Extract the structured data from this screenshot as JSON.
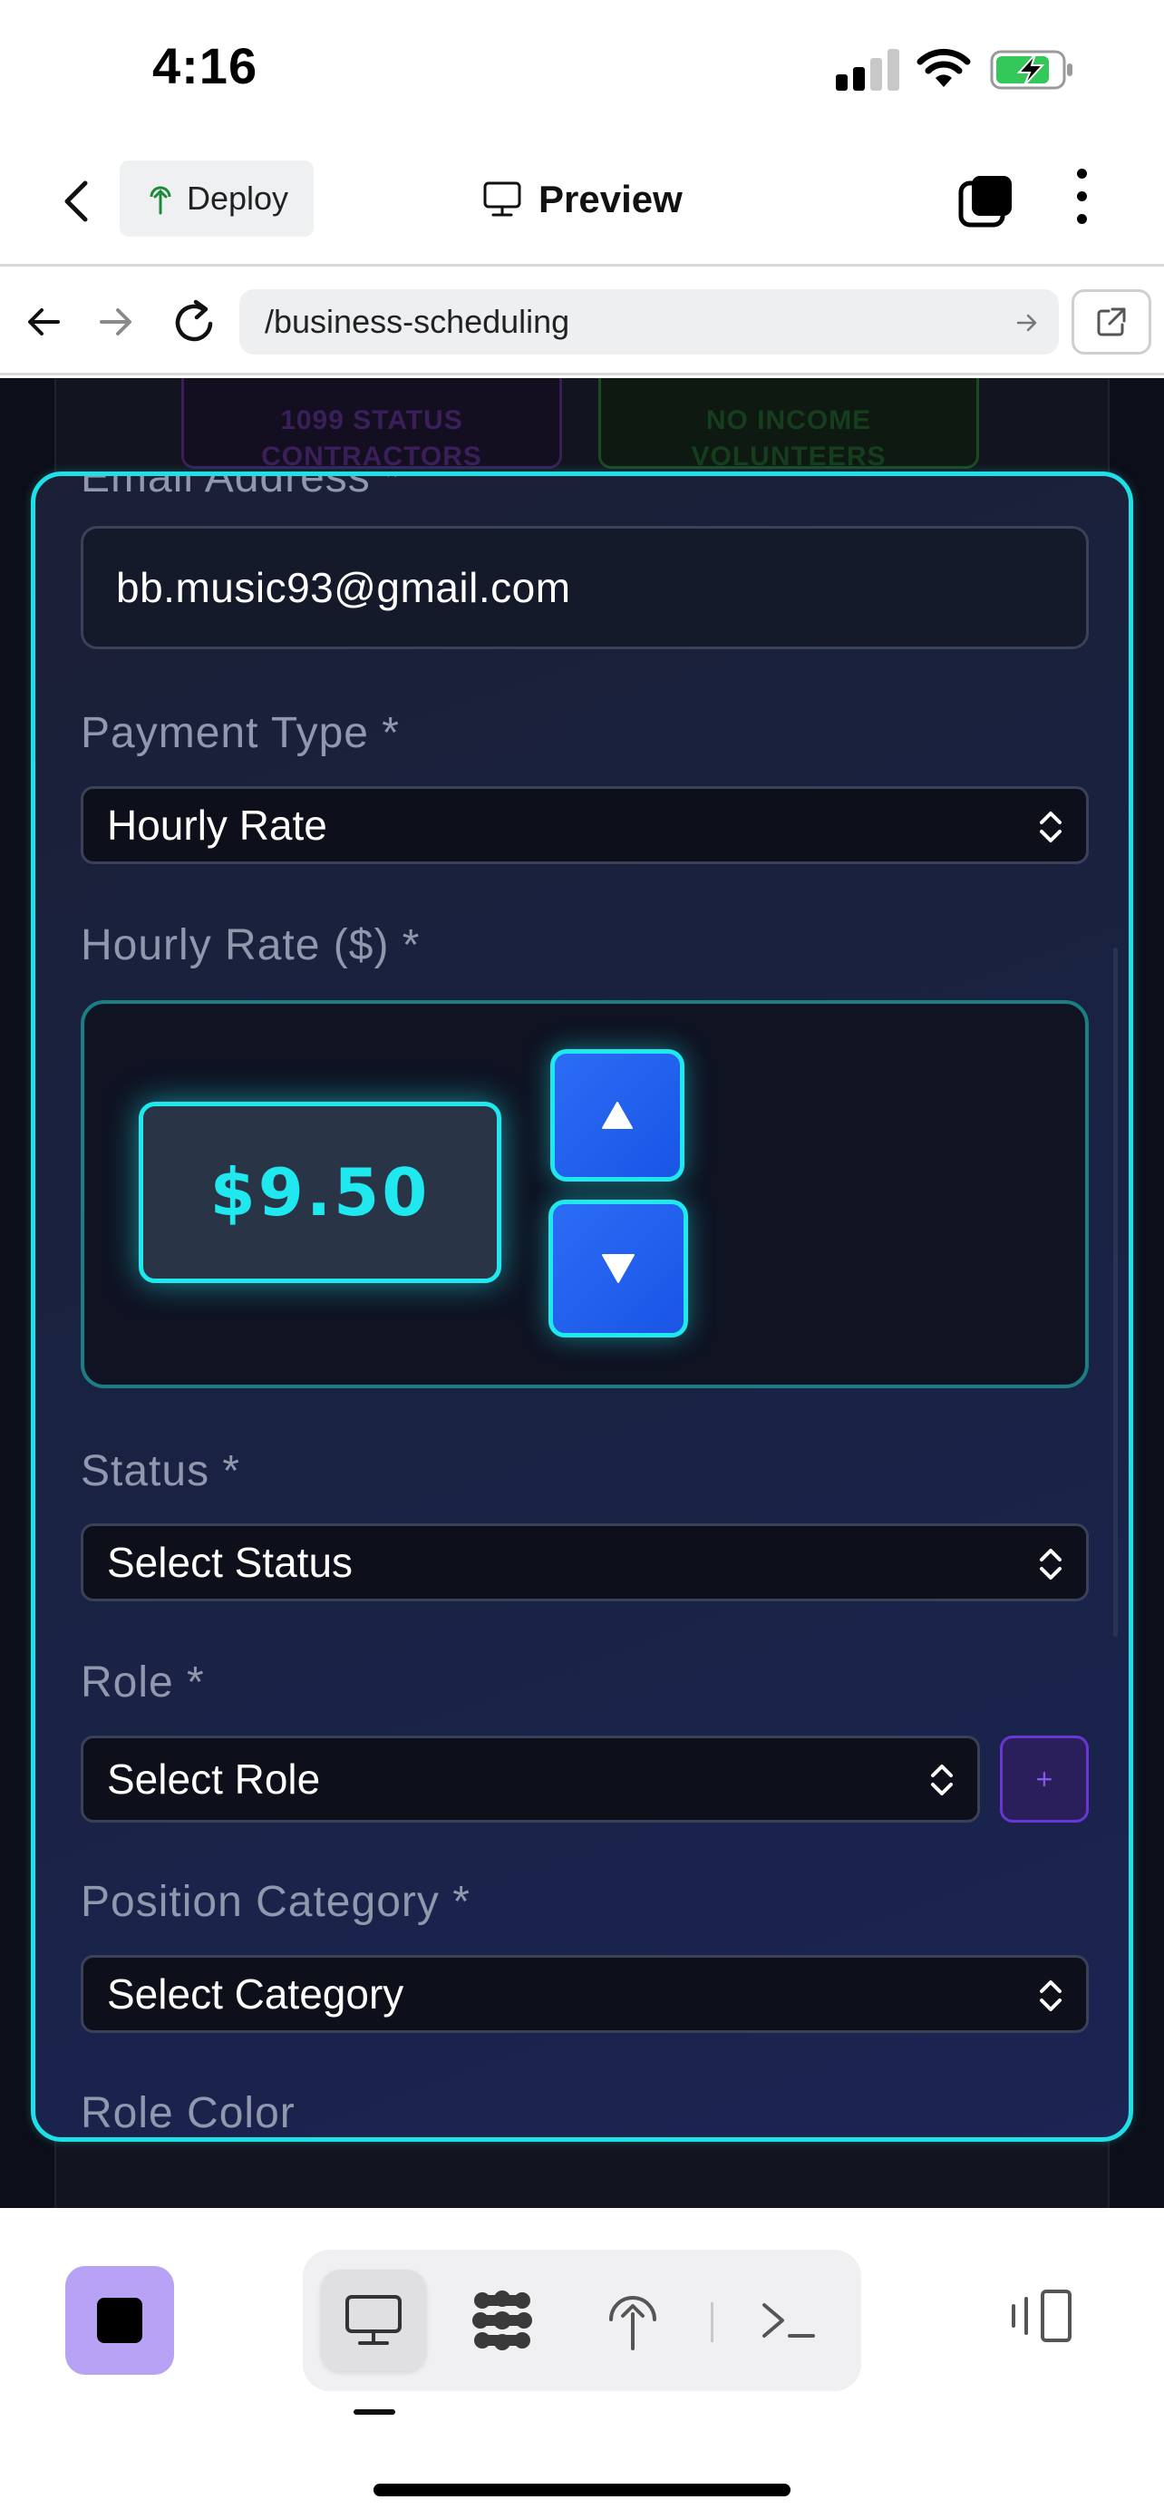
{
  "status_bar": {
    "time": "4:16"
  },
  "app_bar": {
    "deploy_label": "Deploy",
    "preview_label": "Preview"
  },
  "browser": {
    "url": "/business-scheduling"
  },
  "background": {
    "cards": [
      {
        "line1": "1099 STATUS",
        "line2": "CONTRACTORS"
      },
      {
        "line1": "NO INCOME",
        "line2": "VOLUNTEERS"
      }
    ]
  },
  "form": {
    "email_label": "Email Address *",
    "email_value": "bb.music93@gmail.com",
    "payment_type_label": "Payment Type *",
    "payment_type_value": "Hourly Rate",
    "hourly_rate_label": "Hourly Rate ($) *",
    "hourly_rate_value": "$9.50",
    "status_label": "Status *",
    "status_value": "Select Status",
    "role_label": "Role *",
    "role_value": "Select Role",
    "role_add_label": "+",
    "position_category_label": "Position Category *",
    "position_category_value": "Select Category",
    "role_color_label": "Role Color"
  },
  "icons": {
    "up_arrow": "▲",
    "down_arrow": "▼"
  },
  "colors": {
    "accent_cyan": "#1fe0e6",
    "button_blue": "#2b6cf5",
    "stop_purple": "#b8a2f5"
  }
}
